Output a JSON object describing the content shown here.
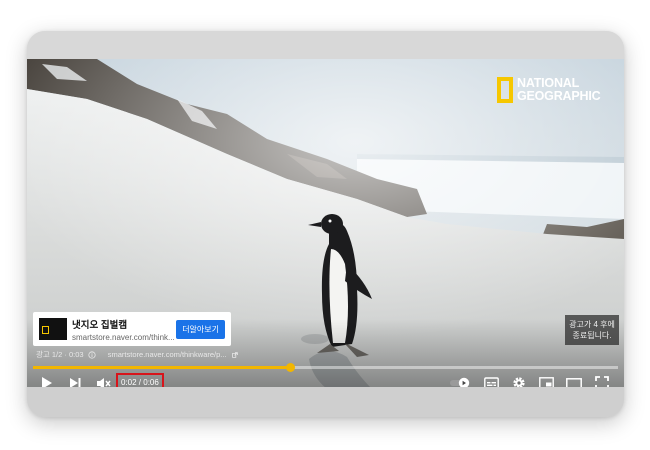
{
  "brand": {
    "line1": "NATIONAL",
    "line2": "GEOGRAPHIC",
    "accent_color": "#f6c700"
  },
  "ad": {
    "title": "냇지오 집벌캠",
    "url": "smartstore.naver.com/think...",
    "cta_label": "더알아보기",
    "meta_label": "광고 1/2 · 0:03",
    "meta_url": "smartstore.naver.com/thinkware/p...",
    "skip_line1": "광고가 4 후에",
    "skip_line2": "종료됩니다."
  },
  "player": {
    "time_display": "0:02 / 0:06",
    "progress_fraction": 0.44,
    "progress_color": "#f2b600",
    "highlight_color": "#d8141b"
  },
  "icons": [
    "play-icon",
    "next-icon",
    "mute-icon",
    "autoplay-toggle-icon",
    "subtitles-icon",
    "settings-gear-icon",
    "miniplayer-icon",
    "theater-mode-icon",
    "fullscreen-icon",
    "info-icon",
    "external-link-icon"
  ]
}
